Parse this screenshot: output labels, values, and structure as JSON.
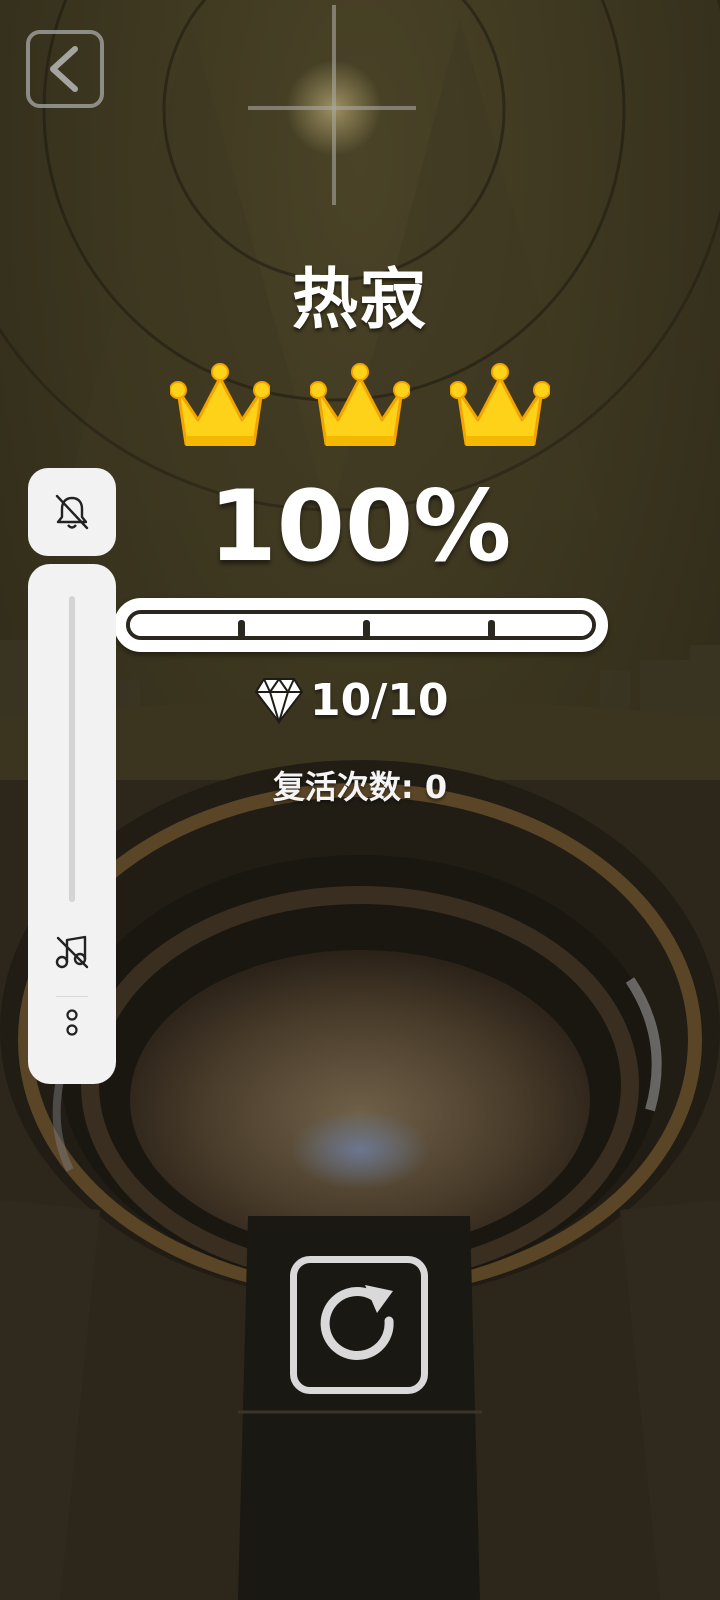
{
  "level": {
    "title": "热寂",
    "crowns_earned": 3,
    "crowns_total": 3,
    "percent_text": "100%",
    "progress_fraction": 1.0,
    "gems_text": "10/10",
    "revive_text": "复活次数: 0"
  },
  "icons": {
    "back": "chevron-left-icon",
    "crown": "crown-icon",
    "gem": "diamond-icon",
    "bell_off": "bell-off-icon",
    "music_off": "music-off-icon",
    "more": "vertical-dots-icon",
    "replay": "replay-icon"
  },
  "colors": {
    "background": "#2b2718",
    "crown_gold": "#ffd21a",
    "text": "#ffffff",
    "panel": "#f2f2f2",
    "track": "#1a1812"
  }
}
